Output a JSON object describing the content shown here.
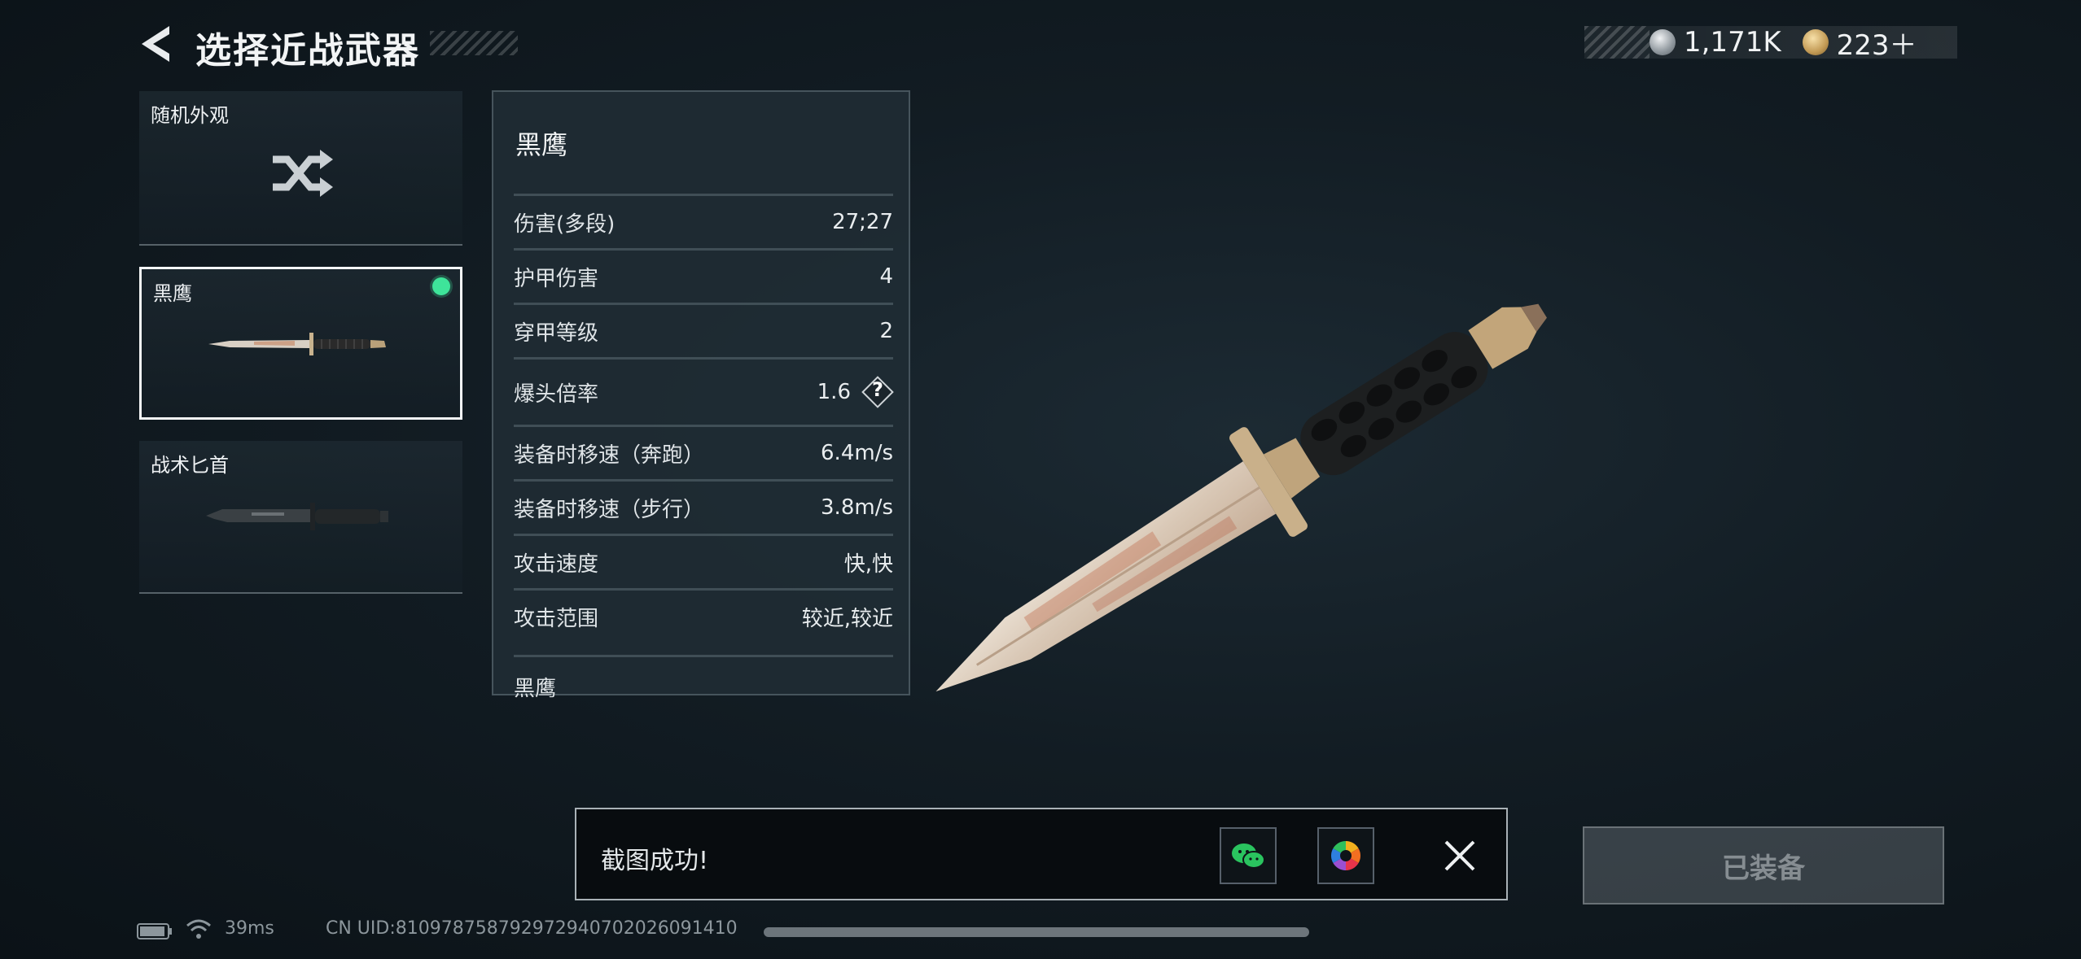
{
  "header": {
    "title": "选择近战武器",
    "currency": [
      {
        "icon": "silver-coin-icon",
        "value": "1,171K"
      },
      {
        "icon": "gold-triangle-coin-icon",
        "value": "223＋"
      }
    ]
  },
  "weapon_list": [
    {
      "label": "随机外观",
      "icon": "shuffle-icon",
      "selected": false
    },
    {
      "label": "黑鹰",
      "selected": true
    },
    {
      "label": "战术匕首",
      "selected": false
    }
  ],
  "panel": {
    "name": "黑鹰",
    "stats": [
      {
        "label": "伤害(多段)",
        "value": "27;27"
      },
      {
        "label": "护甲伤害",
        "value": "4"
      },
      {
        "label": "穿甲等级",
        "value": "2"
      },
      {
        "label": "爆头倍率",
        "value": "1.6",
        "help": "?"
      },
      {
        "label": "装备时移速（奔跑）",
        "value": "6.4m/s"
      },
      {
        "label": "装备时移速（步行）",
        "value": "3.8m/s"
      },
      {
        "label": "攻击速度",
        "value": "快,快"
      },
      {
        "label": "攻击范围",
        "value": "较近,较近"
      }
    ],
    "footer": "黑鹰"
  },
  "toast": {
    "text": "截图成功!",
    "actions": [
      "wechat-icon",
      "photo-album-icon",
      "close-icon"
    ]
  },
  "equip_button": {
    "label": "已装备"
  },
  "status": {
    "ping": "39ms",
    "uid": "CN UID:810978758792972940 70_2026091410",
    "uid_display": "CN UID:810978758792972940702026091410"
  },
  "colors": {
    "selected_dot": "#3ee49a",
    "accent_white": "#f4f6f7"
  }
}
